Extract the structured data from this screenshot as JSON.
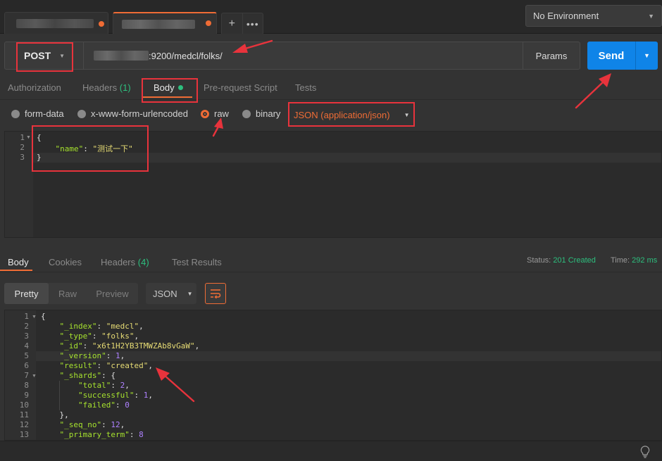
{
  "environment": {
    "label": "No Environment"
  },
  "request": {
    "method": "POST",
    "url_suffix": ":9200/medcl/folks/",
    "params_label": "Params",
    "send_label": "Send"
  },
  "request_tabs": [
    {
      "label": "Authorization"
    },
    {
      "label": "Headers",
      "count": "(1)"
    },
    {
      "label": "Body"
    },
    {
      "label": "Pre-request Script"
    },
    {
      "label": "Tests"
    }
  ],
  "body_options": {
    "form_data": "form-data",
    "urlencoded": "x-www-form-urlencoded",
    "raw": "raw",
    "binary": "binary",
    "content_type": "JSON (application/json)"
  },
  "request_body": {
    "line_numbers": [
      "1",
      "2",
      "3"
    ],
    "line1": "{",
    "key": "\"name\"",
    "colon": ": ",
    "value": "\"测试一下\"",
    "line3": "}"
  },
  "response_tabs": [
    {
      "label": "Body"
    },
    {
      "label": "Cookies"
    },
    {
      "label": "Headers",
      "count": "(4)"
    },
    {
      "label": "Test Results"
    }
  ],
  "status": {
    "label": "Status:",
    "value": "201 Created",
    "time_label": "Time:",
    "time_value": "292 ms"
  },
  "view_modes": {
    "pretty": "Pretty",
    "raw": "Raw",
    "preview": "Preview",
    "format": "JSON"
  },
  "response_body": {
    "line_numbers": [
      "1",
      "2",
      "3",
      "4",
      "5",
      "6",
      "7",
      "8",
      "9",
      "10",
      "11",
      "12",
      "13"
    ],
    "l1": "{",
    "index_key": "\"_index\"",
    "index_val": "\"medcl\"",
    "type_key": "\"_type\"",
    "type_val": "\"folks\"",
    "id_key": "\"_id\"",
    "id_val": "\"x6t1H2YB3TMWZAb8vGaW\"",
    "version_key": "\"_version\"",
    "version_val": "1",
    "result_key": "\"result\"",
    "result_val": "\"created\"",
    "shards_key": "\"_shards\"",
    "shards_open": "{",
    "total_key": "\"total\"",
    "total_val": "2",
    "successful_key": "\"successful\"",
    "successful_val": "1",
    "failed_key": "\"failed\"",
    "failed_val": "0",
    "shards_close": "},",
    "seq_key": "\"_seq_no\"",
    "seq_val": "12",
    "primary_key": "\"_primary_term\"",
    "primary_val": "8"
  },
  "colors": {
    "accent": "#ef6c35",
    "send": "#0f84e8",
    "status_ok": "#2dbf7e",
    "annotation": "#e8333c"
  }
}
